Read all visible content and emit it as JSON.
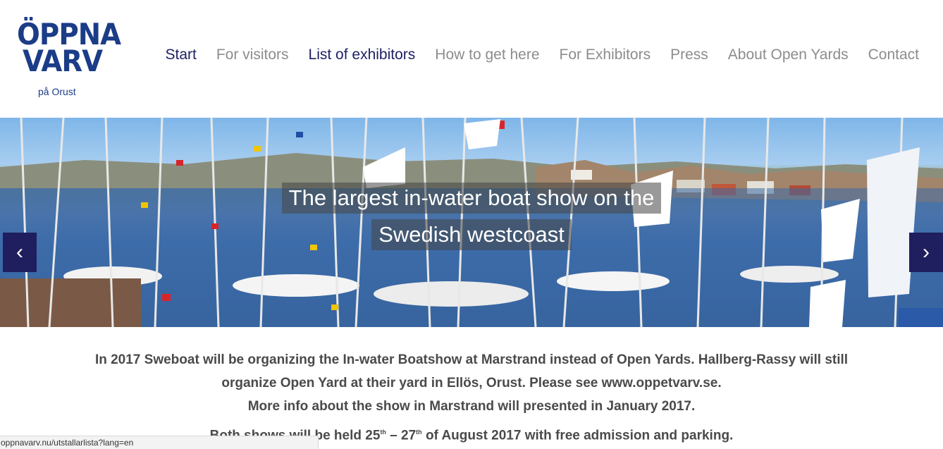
{
  "logo": {
    "line1": "ÖPPNA",
    "line2": "VARV",
    "sub": "på Orust"
  },
  "nav": [
    {
      "label": "Start",
      "active": true
    },
    {
      "label": "For visitors",
      "active": false
    },
    {
      "label": "List of exhibitors",
      "active": true
    },
    {
      "label": "How to get here",
      "active": false
    },
    {
      "label": "For Exhibitors",
      "active": false
    },
    {
      "label": "Press",
      "active": false
    },
    {
      "label": "About Open Yards",
      "active": false
    },
    {
      "label": "Contact",
      "active": false
    }
  ],
  "hero": {
    "caption_line1": "The largest in-water boat show on the",
    "caption_line2": "Swedish westcoast",
    "prev_icon": "chevron-left-icon",
    "next_icon": "chevron-right-icon",
    "prev_glyph": "‹",
    "next_glyph": "›"
  },
  "content": {
    "p1": "In 2017 Sweboat will be organizing the In-water Boatshow at Marstrand instead of Open Yards. Hallberg-Rassy will still",
    "p2": "organize Open Yard at their yard in Ellös, Orust. Please see www.oppetvarv.se.",
    "p3": "More info about the show in Marstrand will presented in January 2017.",
    "p4_a": "Both shows will be held 25",
    "p4_sup1": "th",
    "p4_b": " – 27",
    "p4_sup2": "th",
    "p4_c": " of August 2017 with free admission and parking."
  },
  "status_bar": {
    "url": "oppnavarv.nu/utstallarlista?lang=en"
  },
  "colors": {
    "brand": "#1b3c87",
    "nav_active": "#1d1f64",
    "nav_inactive": "#8c8c8c",
    "arrow_bg": "#1f1e5e",
    "body_text": "#4a4a4a"
  }
}
